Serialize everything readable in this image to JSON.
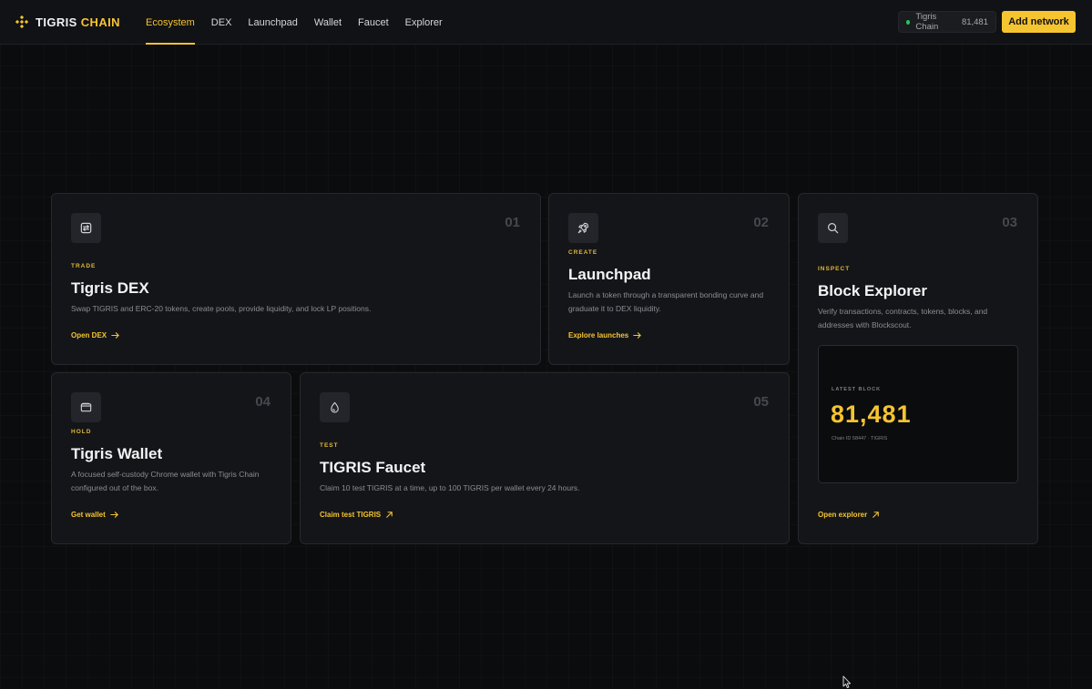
{
  "brand": {
    "name": "TIGRIS",
    "accent": "CHAIN"
  },
  "nav": {
    "links": [
      {
        "label": "Ecosystem",
        "active": true
      },
      {
        "label": "DEX"
      },
      {
        "label": "Launchpad"
      },
      {
        "label": "Wallet"
      },
      {
        "label": "Faucet"
      },
      {
        "label": "Explorer"
      }
    ],
    "chain_name": "Tigris Chain",
    "chain_block": "81,481",
    "add_network_label": "Add network"
  },
  "cards": {
    "dex": {
      "num": "01",
      "tag": "TRADE",
      "title": "Tigris DEX",
      "desc": "Swap TIGRIS and ERC-20 tokens, create pools, provide liquidity, and lock LP positions.",
      "link": "Open DEX",
      "icon": "swap-icon"
    },
    "launchpad": {
      "num": "02",
      "tag": "CREATE",
      "title": "Launchpad",
      "desc": "Launch a token through a transparent bonding curve and graduate it to DEX liquidity.",
      "link": "Explore launches",
      "icon": "rocket-icon"
    },
    "explorer": {
      "num": "03",
      "tag": "INSPECT",
      "title": "Block Explorer",
      "desc": "Verify transactions, contracts, tokens, blocks, and addresses with Blockscout.",
      "link": "Open explorer",
      "icon": "search-icon",
      "latest_label": "LATEST BLOCK",
      "latest_value": "81,481",
      "latest_meta": "Chain ID 58447 · TIGRIS"
    },
    "wallet": {
      "num": "04",
      "tag": "HOLD",
      "title": "Tigris Wallet",
      "desc": "A focused self-custody Chrome wallet with Tigris Chain configured out of the box.",
      "link": "Get wallet",
      "icon": "wallet-icon"
    },
    "faucet": {
      "num": "05",
      "tag": "TEST",
      "title": "TIGRIS Faucet",
      "desc": "Claim 10 test TIGRIS at a time, up to 100 TIGRIS per wallet every 24 hours.",
      "link": "Claim test TIGRIS",
      "icon": "droplet-icon"
    }
  },
  "colors": {
    "accent": "#f5c431",
    "background": "#0b0c0e",
    "card": "#141518",
    "status": "#22c55e"
  }
}
